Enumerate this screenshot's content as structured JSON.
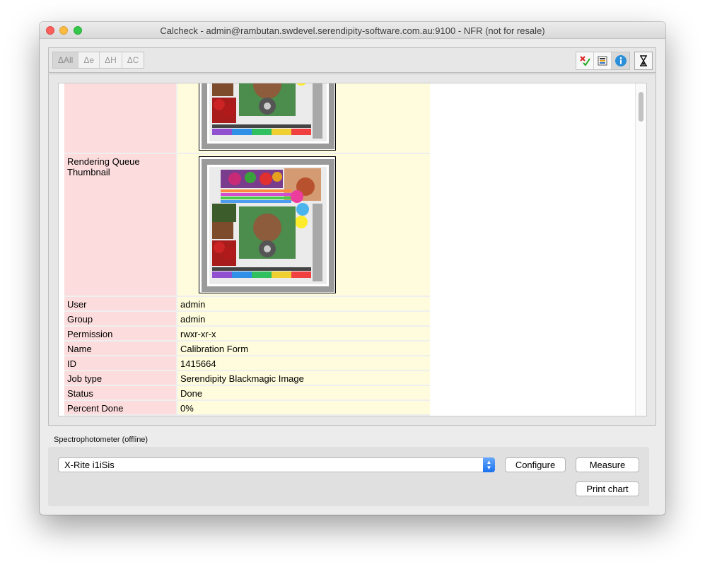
{
  "window": {
    "title": "Calcheck - admin@rambutan.swdevel.serendipity-software.com.au:9100 - NFR (not for resale)"
  },
  "toolbar": {
    "delta_buttons": [
      {
        "label": "ΔAll",
        "active": true
      },
      {
        "label": "Δe",
        "active": false
      },
      {
        "label": "ΔH",
        "active": false
      },
      {
        "label": "ΔC",
        "active": false
      }
    ],
    "tool_icons": [
      "check-cross-icon",
      "list-icon",
      "info-icon",
      "hourglass-icon"
    ]
  },
  "details": {
    "thumbnail_row": {
      "label": "Rendering Queue Thumbnail"
    },
    "rows": [
      {
        "label": "User",
        "value": "admin"
      },
      {
        "label": "Group",
        "value": "admin"
      },
      {
        "label": "Permission",
        "value": "rwxr-xr-x"
      },
      {
        "label": "Name",
        "value": "Calibration Form"
      },
      {
        "label": "ID",
        "value": "1415664"
      },
      {
        "label": "Job type",
        "value": "Serendipity Blackmagic Image"
      },
      {
        "label": "Status",
        "value": "Done"
      },
      {
        "label": "Percent Done",
        "value": "0%"
      }
    ]
  },
  "spectrophotometer": {
    "label": "Spectrophotometer (offline)",
    "device": "X-Rite i1iSis",
    "configure_label": "Configure",
    "measure_label": "Measure",
    "print_chart_label": "Print chart"
  },
  "colors": {
    "label_bg": "#fcdcdc",
    "value_bg": "#fefcdc",
    "select_accent": "#1a72f0",
    "close": "#fc605c",
    "minimize": "#fdbc40",
    "maximize": "#34c84a"
  }
}
